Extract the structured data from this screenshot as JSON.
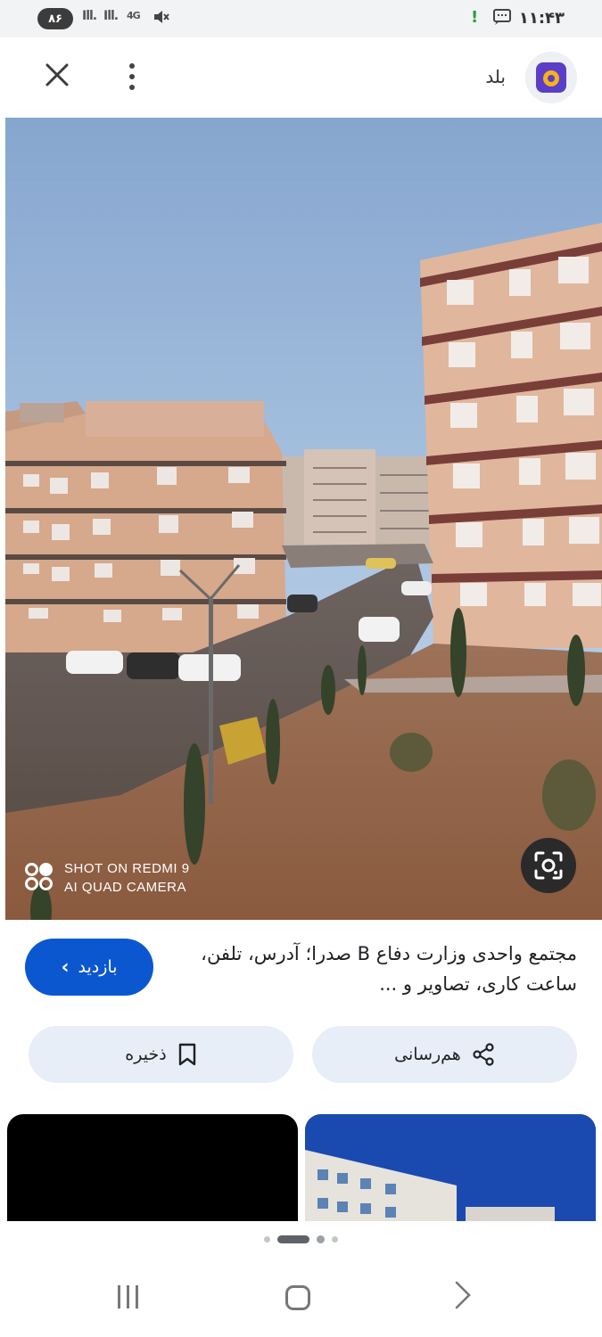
{
  "status_bar": {
    "battery": "۸۶",
    "signal_1": "Ill.",
    "signal_2": "Ill.",
    "network": "4G",
    "time": "۱۱:۴۳"
  },
  "header": {
    "app_name": "بلد"
  },
  "photo": {
    "watermark_line1": "SHOT ON REDMI 9",
    "watermark_line2": "AI QUAD CAMERA"
  },
  "result": {
    "title": "مجتمع واحدی وزارت دفاع B صدرا؛ آدرس، تلفن، ساعت کاری، تصاویر و ...",
    "visit_label": "بازدید"
  },
  "actions": {
    "share_label": "هم‌رسانی",
    "save_label": "ذخیره"
  },
  "colors": {
    "accent": "#0b57d0",
    "chip_bg": "#e8eef7"
  }
}
